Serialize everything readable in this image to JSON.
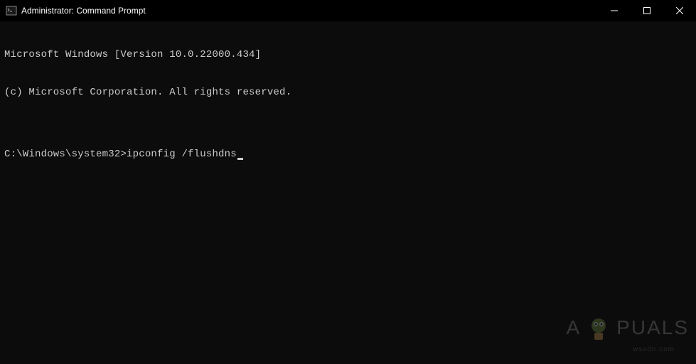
{
  "titlebar": {
    "title": "Administrator: Command Prompt"
  },
  "terminal": {
    "line1": "Microsoft Windows [Version 10.0.22000.434]",
    "line2": "(c) Microsoft Corporation. All rights reserved.",
    "blank": "",
    "prompt": "C:\\Windows\\system32>",
    "command": "ipconfig /flushdns"
  },
  "watermark": {
    "text_left": "A",
    "text_right": "PUALS",
    "sub": "wsxdn.com"
  }
}
